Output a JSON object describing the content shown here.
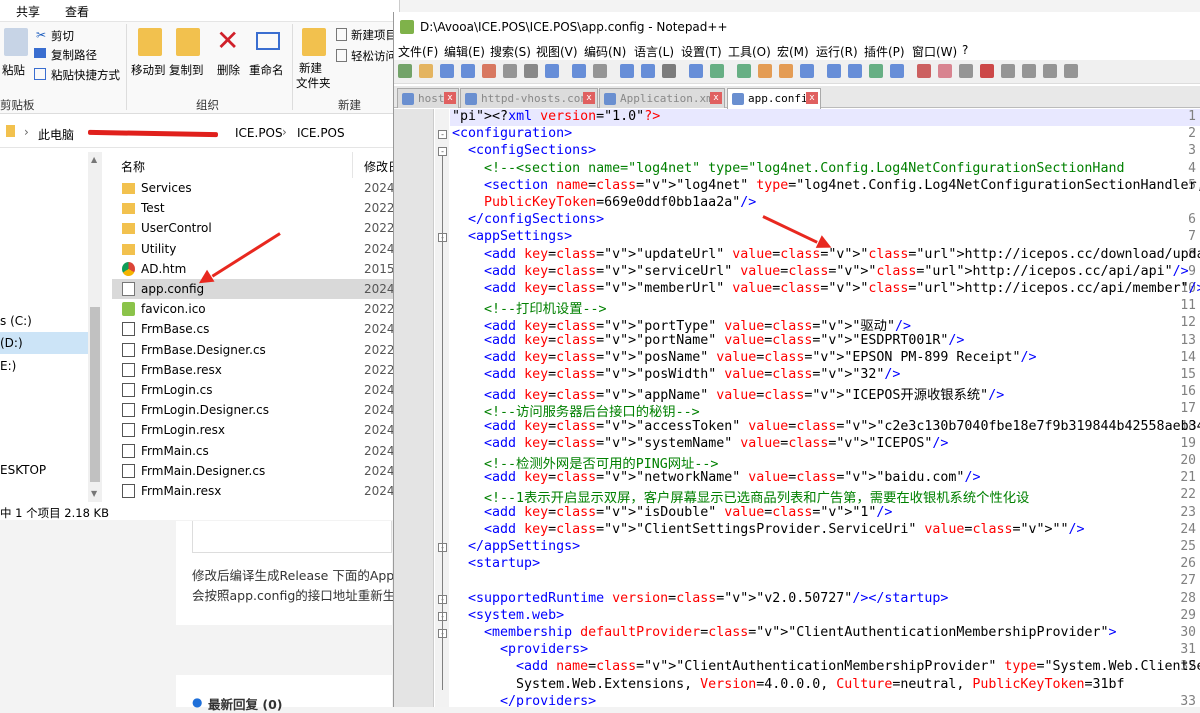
{
  "explorer": {
    "ribbon_tabs": [
      "共享",
      "查看"
    ],
    "clipboard": {
      "paste": "粘贴",
      "cut": "剪切",
      "copy_path": "复制路径",
      "paste_shortcut": "粘贴快捷方式",
      "group": "剪贴板"
    },
    "organize": {
      "move_to": "移动到",
      "copy_to": "复制到",
      "delete": "删除",
      "rename": "重命名",
      "group": "组织"
    },
    "new": {
      "new_folder_line1": "新建",
      "new_folder_line2": "文件夹",
      "new_item": "新建项目",
      "easy_access": "轻松访问",
      "group": "新建"
    },
    "address": {
      "this_pc": "此电脑",
      "crumb1": "ICE.POS",
      "crumb2": "ICE.POS"
    },
    "columns": {
      "name": "名称",
      "modified": "修改日"
    },
    "nav_items": [
      "s (C:)",
      "(D:)",
      "E:)",
      "ESKTOP"
    ],
    "files": [
      {
        "name": "Services",
        "date": "2024",
        "icon": "folder-icon"
      },
      {
        "name": "Test",
        "date": "2022",
        "icon": "folder-icon"
      },
      {
        "name": "UserControl",
        "date": "2022",
        "icon": "folder-icon"
      },
      {
        "name": "Utility",
        "date": "2024",
        "icon": "folder-icon"
      },
      {
        "name": "AD.htm",
        "date": "2015",
        "icon": "chrome-icon"
      },
      {
        "name": "app.config",
        "date": "2024",
        "icon": "config-file-icon"
      },
      {
        "name": "favicon.ico",
        "date": "2022",
        "icon": "ico-file-icon"
      },
      {
        "name": "FrmBase.cs",
        "date": "2024",
        "icon": "cs-file-icon"
      },
      {
        "name": "FrmBase.Designer.cs",
        "date": "2022",
        "icon": "cs-file-icon"
      },
      {
        "name": "FrmBase.resx",
        "date": "2022",
        "icon": "resx-file-icon"
      },
      {
        "name": "FrmLogin.cs",
        "date": "2024",
        "icon": "cs-file-icon"
      },
      {
        "name": "FrmLogin.Designer.cs",
        "date": "2024",
        "icon": "cs-file-icon"
      },
      {
        "name": "FrmLogin.resx",
        "date": "2024",
        "icon": "resx-file-icon"
      },
      {
        "name": "FrmMain.cs",
        "date": "2024",
        "icon": "cs-file-icon"
      },
      {
        "name": "FrmMain.Designer.cs",
        "date": "2024",
        "icon": "cs-file-icon"
      },
      {
        "name": "FrmMain.resx",
        "date": "2024",
        "icon": "resx-file-icon"
      }
    ],
    "status": "中 1 个项目  2.18 KB"
  },
  "web": {
    "line1": "修改后编译生成Release 下面的App",
    "line2": "会按照app.config的接口地址重新生",
    "replies": "最新回复 (0)"
  },
  "npp": {
    "title": "D:\\Avooa\\ICE.POS\\ICE.POS\\app.config - Notepad++",
    "menu": [
      "文件(F)",
      "编辑(E)",
      "搜索(S)",
      "视图(V)",
      "编码(N)",
      "语言(L)",
      "设置(T)",
      "工具(O)",
      "宏(M)",
      "运行(R)",
      "插件(P)",
      "窗口(W)",
      "?"
    ],
    "tabs": [
      "hosts",
      "httpd-vhosts.conf",
      "Application.xml",
      "app.config"
    ],
    "lines": [
      {
        "n": "1",
        "txt": "<?xml version=\"1.0\"?>"
      },
      {
        "n": "2",
        "txt": "<configuration>"
      },
      {
        "n": "3",
        "txt": "  <configSections>"
      },
      {
        "n": "4",
        "txt": "    <!--<section name=\"log4net\" type=\"log4net.Config.Log4NetConfigurationSectionHand"
      },
      {
        "n": "5",
        "txt": "    <section name=\"log4net\" type=\"log4net.Config.Log4NetConfigurationSectionHandler,"
      },
      {
        "n": "",
        "txt": "    PublicKeyToken=669e0ddf0bb1aa2a\"/>"
      },
      {
        "n": "6",
        "txt": "  </configSections>"
      },
      {
        "n": "7",
        "txt": "  <appSettings>"
      },
      {
        "n": "8",
        "txt": "    <add key=\"updateUrl\" value=\"http://icepos.cc/download/update.xml\"/>"
      },
      {
        "n": "9",
        "txt": "    <add key=\"serviceUrl\" value=\"http://icepos.cc/api/api\"/>"
      },
      {
        "n": "10",
        "txt": "    <add key=\"memberUrl\" value=\"http://icepos.cc/api/member\"/>"
      },
      {
        "n": "11",
        "txt": "    <!--打印机设置-->"
      },
      {
        "n": "12",
        "txt": "    <add key=\"portType\" value=\"驱动\"/>"
      },
      {
        "n": "13",
        "txt": "    <add key=\"portName\" value=\"ESDPRT001R\"/>"
      },
      {
        "n": "14",
        "txt": "    <add key=\"posName\" value=\"EPSON PM-899 Receipt\"/>"
      },
      {
        "n": "15",
        "txt": "    <add key=\"posWidth\" value=\"32\"/>"
      },
      {
        "n": "16",
        "txt": "    <add key=\"appName\" value=\"ICEPOS开源收银系统\"/>"
      },
      {
        "n": "17",
        "txt": "    <!--访问服务器后台接口的秘钥-->"
      },
      {
        "n": "18",
        "txt": "    <add key=\"accessToken\" value=\"c2e3c130b7040fbe18e7f9b319844b42558aeb34\"/>"
      },
      {
        "n": "19",
        "txt": "    <add key=\"systemName\" value=\"ICEPOS\"/>"
      },
      {
        "n": "20",
        "txt": "    <!--检测外网是否可用的PING网址-->"
      },
      {
        "n": "21",
        "txt": "    <add key=\"networkName\" value=\"baidu.com\"/>"
      },
      {
        "n": "22",
        "txt": "    <!--1表示开启显示双屏，客户屏幕显示已选商品列表和广告第，需要在收银机系统个性化设"
      },
      {
        "n": "23",
        "txt": "    <add key=\"isDouble\" value=\"1\"/>"
      },
      {
        "n": "24",
        "txt": "    <add key=\"ClientSettingsProvider.ServiceUri\" value=\"\"/>"
      },
      {
        "n": "25",
        "txt": "  </appSettings>"
      },
      {
        "n": "26",
        "txt": "  <startup>"
      },
      {
        "n": "27",
        "txt": ""
      },
      {
        "n": "28",
        "txt": "  <supportedRuntime version=\"v2.0.50727\"/></startup>"
      },
      {
        "n": "29",
        "txt": "  <system.web>"
      },
      {
        "n": "30",
        "txt": "    <membership defaultProvider=\"ClientAuthenticationMembershipProvider\">"
      },
      {
        "n": "31",
        "txt": "      <providers>"
      },
      {
        "n": "32",
        "txt": "        <add name=\"ClientAuthenticationMembershipProvider\" type=\"System.Web.ClientSe"
      },
      {
        "n": "",
        "txt": "        System.Web.Extensions, Version=4.0.0.0, Culture=neutral, PublicKeyToken=31bf"
      },
      {
        "n": "33",
        "txt": "      </providers>"
      }
    ]
  },
  "colors": {
    "tag": "#0000ff",
    "attr": "#ff0000",
    "value": "#8000ff",
    "comment": "#008000",
    "arrow": "#e8281f"
  }
}
